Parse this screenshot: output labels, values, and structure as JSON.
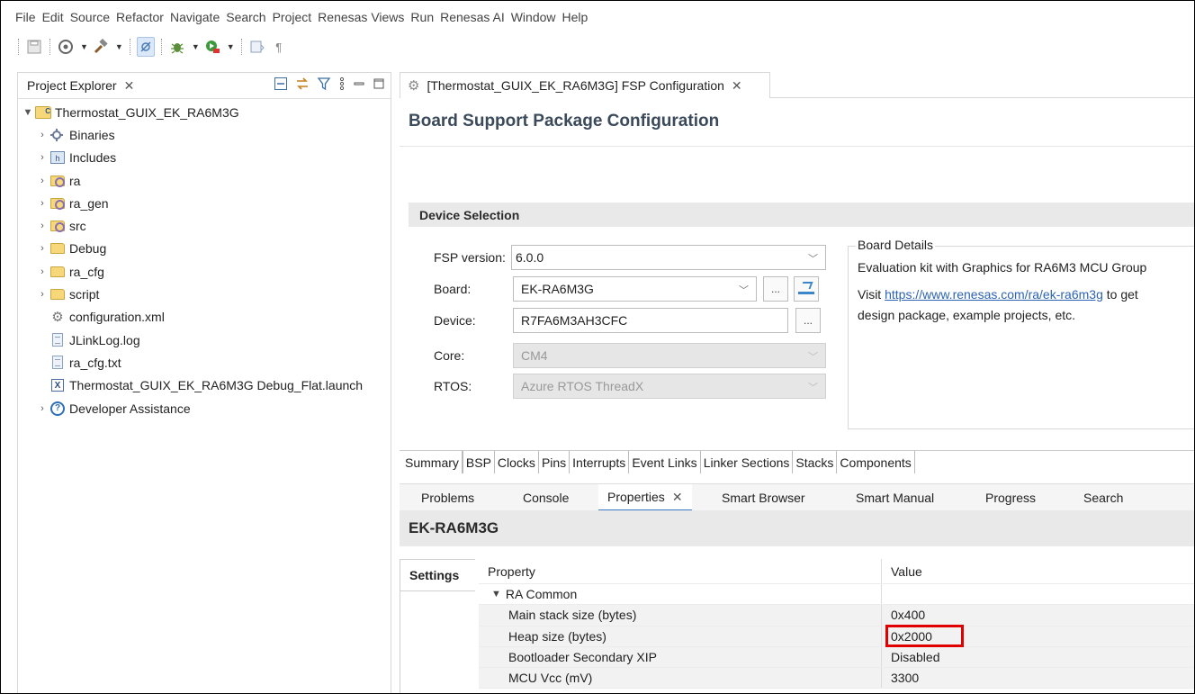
{
  "menu": [
    "File",
    "Edit",
    "Source",
    "Refactor",
    "Navigate",
    "Search",
    "Project",
    "Renesas Views",
    "Run",
    "Renesas AI",
    "Window",
    "Help"
  ],
  "toolbar": {
    "icons": [
      "save-icon",
      "target-icon",
      "hammer-icon",
      "skip-breakpoints-icon",
      "debug-icon",
      "run-icon",
      "console-icon",
      "pilcrow-icon"
    ]
  },
  "project_explorer": {
    "tab_label": "Project Explorer",
    "tab_close": "✕",
    "root": "Thermostat_GUIX_EK_RA6M3G",
    "items": [
      {
        "label": "Binaries",
        "icon": "binaries-icon",
        "expandable": true
      },
      {
        "label": "Includes",
        "icon": "includes-icon",
        "expandable": true
      },
      {
        "label": "ra",
        "icon": "source-folder-icon",
        "expandable": true
      },
      {
        "label": "ra_gen",
        "icon": "source-folder-icon",
        "expandable": true
      },
      {
        "label": "src",
        "icon": "source-folder-icon",
        "expandable": true
      },
      {
        "label": "Debug",
        "icon": "folder-icon",
        "expandable": true
      },
      {
        "label": "ra_cfg",
        "icon": "folder-icon",
        "expandable": true
      },
      {
        "label": "script",
        "icon": "folder-icon",
        "expandable": true
      },
      {
        "label": "configuration.xml",
        "icon": "gear-file-icon",
        "expandable": false
      },
      {
        "label": "JLinkLog.log",
        "icon": "text-file-icon",
        "expandable": false
      },
      {
        "label": "ra_cfg.txt",
        "icon": "text-file-icon",
        "expandable": false
      },
      {
        "label": "Thermostat_GUIX_EK_RA6M3G Debug_Flat.launch",
        "icon": "launch-file-icon",
        "expandable": false
      },
      {
        "label": "Developer Assistance",
        "icon": "help-icon",
        "expandable": true
      }
    ]
  },
  "editor": {
    "tab_label": "[Thermostat_GUIX_EK_RA6M3G] FSP Configuration",
    "tab_close": "✕",
    "title": "Board Support Package Configuration",
    "device_selection": {
      "header": "Device Selection",
      "fsp_version_label": "FSP version:",
      "fsp_version_value": "6.0.0",
      "board_label": "Board:",
      "board_value": "EK-RA6M3G",
      "device_label": "Device:",
      "device_value": "R7FA6M3AH3CFC",
      "core_label": "Core:",
      "core_value": "CM4",
      "rtos_label": "RTOS:",
      "rtos_value": "Azure RTOS ThreadX",
      "ellipsis": "..."
    },
    "board_details": {
      "legend": "Board Details",
      "line1": "Evaluation kit with Graphics for RA6M3 MCU Group",
      "visit": "Visit ",
      "link": "https://www.renesas.com/ra/ek-ra6m3g",
      "after_link": " to get",
      "line3": "design package, example projects, etc."
    },
    "config_tabs": [
      "Summary",
      "BSP",
      "Clocks",
      "Pins",
      "Interrupts",
      "Event Links",
      "Linker Sections",
      "Stacks",
      "Components"
    ],
    "active_config_tab": "BSP"
  },
  "views": {
    "tabs": [
      "Problems",
      "Console",
      "Properties",
      "Smart Browser",
      "Smart Manual",
      "Progress",
      "Search"
    ],
    "active": "Properties",
    "close": "✕"
  },
  "properties": {
    "header": "EK-RA6M3G",
    "settings_tab": "Settings",
    "col_property": "Property",
    "col_value": "Value",
    "group": "RA Common",
    "rows": [
      {
        "property": "Main stack size (bytes)",
        "value": "0x400"
      },
      {
        "property": "Heap size (bytes)",
        "value": "0x2000"
      },
      {
        "property": "Bootloader Secondary XIP",
        "value": "Disabled"
      },
      {
        "property": "MCU Vcc (mV)",
        "value": "3300"
      }
    ],
    "highlight_color": "#e00000"
  }
}
